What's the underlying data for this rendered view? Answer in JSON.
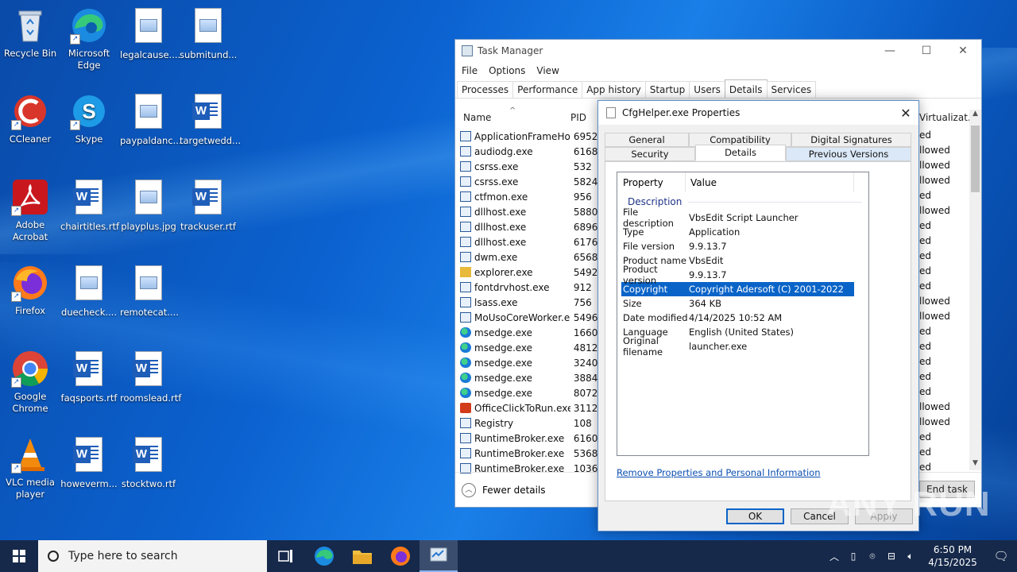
{
  "desktop": {
    "icons": [
      {
        "label": "Recycle Bin"
      },
      {
        "label": "Microsoft Edge"
      },
      {
        "label": "legalcause...."
      },
      {
        "label": "submitund..."
      },
      {
        "label": "CCleaner"
      },
      {
        "label": "Skype"
      },
      {
        "label": "paypaldanc..."
      },
      {
        "label": "targetwedd..."
      },
      {
        "label": "Adobe Acrobat"
      },
      {
        "label": "chairtitles.rtf"
      },
      {
        "label": "playplus.jpg"
      },
      {
        "label": "trackuser.rtf"
      },
      {
        "label": "Firefox"
      },
      {
        "label": "duecheck...."
      },
      {
        "label": "remotecat...."
      },
      {
        "label": "Google Chrome"
      },
      {
        "label": "faqsports.rtf"
      },
      {
        "label": "roomslead.rtf"
      },
      {
        "label": "VLC media player"
      },
      {
        "label": "howeverm..."
      },
      {
        "label": "stocktwo.rtf"
      }
    ]
  },
  "task_manager": {
    "title": "Task Manager",
    "menu": [
      "File",
      "Options",
      "View"
    ],
    "tabs": [
      "Processes",
      "Performance",
      "App history",
      "Startup",
      "Users",
      "Details",
      "Services"
    ],
    "active_tab": "Details",
    "columns": {
      "name": "Name",
      "pid": "PID",
      "virtualization": "Virtualizat..."
    },
    "processes": [
      {
        "name": "ApplicationFrameHo...",
        "pid": "6952",
        "virt": "ed"
      },
      {
        "name": "audiodg.exe",
        "pid": "6168",
        "virt": "llowed"
      },
      {
        "name": "csrss.exe",
        "pid": "532",
        "virt": "llowed"
      },
      {
        "name": "csrss.exe",
        "pid": "5824",
        "virt": "llowed"
      },
      {
        "name": "ctfmon.exe",
        "pid": "956",
        "virt": "ed"
      },
      {
        "name": "dllhost.exe",
        "pid": "5880",
        "virt": "llowed"
      },
      {
        "name": "dllhost.exe",
        "pid": "6896",
        "virt": "ed"
      },
      {
        "name": "dllhost.exe",
        "pid": "6176",
        "virt": "ed"
      },
      {
        "name": "dwm.exe",
        "pid": "6568",
        "virt": "ed"
      },
      {
        "name": "explorer.exe",
        "pid": "5492",
        "virt": "ed"
      },
      {
        "name": "fontdrvhost.exe",
        "pid": "912",
        "virt": "ed"
      },
      {
        "name": "lsass.exe",
        "pid": "756",
        "virt": "llowed"
      },
      {
        "name": "MoUsoCoreWorker.e...",
        "pid": "5496",
        "virt": "llowed"
      },
      {
        "name": "msedge.exe",
        "pid": "1660",
        "virt": "ed"
      },
      {
        "name": "msedge.exe",
        "pid": "4812",
        "virt": "ed"
      },
      {
        "name": "msedge.exe",
        "pid": "3240",
        "virt": "ed"
      },
      {
        "name": "msedge.exe",
        "pid": "3884",
        "virt": "ed"
      },
      {
        "name": "msedge.exe",
        "pid": "8072",
        "virt": "ed"
      },
      {
        "name": "OfficeClickToRun.exe",
        "pid": "3112",
        "virt": "llowed"
      },
      {
        "name": "Registry",
        "pid": "108",
        "virt": "llowed"
      },
      {
        "name": "RuntimeBroker.exe",
        "pid": "6160",
        "virt": "ed"
      },
      {
        "name": "RuntimeBroker.exe",
        "pid": "5368",
        "virt": "ed"
      },
      {
        "name": "RuntimeBroker.exe",
        "pid": "1036",
        "virt": "ed"
      }
    ],
    "fewer_details": "Fewer details",
    "end_task": "End task"
  },
  "properties_dialog": {
    "title": "CfgHelper.exe Properties",
    "tabs_top": [
      "General",
      "Compatibility",
      "Digital Signatures"
    ],
    "tabs_bottom": [
      "Security",
      "Details",
      "Previous Versions"
    ],
    "active_tab": "Details",
    "list_header": {
      "property": "Property",
      "value": "Value"
    },
    "group": "Description",
    "rows": [
      {
        "k": "File description",
        "v": "VbsEdit Script Launcher"
      },
      {
        "k": "Type",
        "v": "Application"
      },
      {
        "k": "File version",
        "v": "9.9.13.7"
      },
      {
        "k": "Product name",
        "v": "VbsEdit"
      },
      {
        "k": "Product version",
        "v": "9.9.13.7"
      },
      {
        "k": "Copyright",
        "v": "Copyright Adersoft (C) 2001-2022"
      },
      {
        "k": "Size",
        "v": "364 KB"
      },
      {
        "k": "Date modified",
        "v": "4/14/2025 10:52 AM"
      },
      {
        "k": "Language",
        "v": "English (United States)"
      },
      {
        "k": "Original filename",
        "v": "launcher.exe"
      }
    ],
    "selected_row": "Copyright",
    "remove_link": "Remove Properties and Personal Information",
    "ok": "OK",
    "cancel": "Cancel",
    "apply": "Apply"
  },
  "taskbar": {
    "search_placeholder": "Type here to search",
    "time": "6:50 PM",
    "date": "4/15/2025"
  },
  "watermark": "ANY RUN"
}
